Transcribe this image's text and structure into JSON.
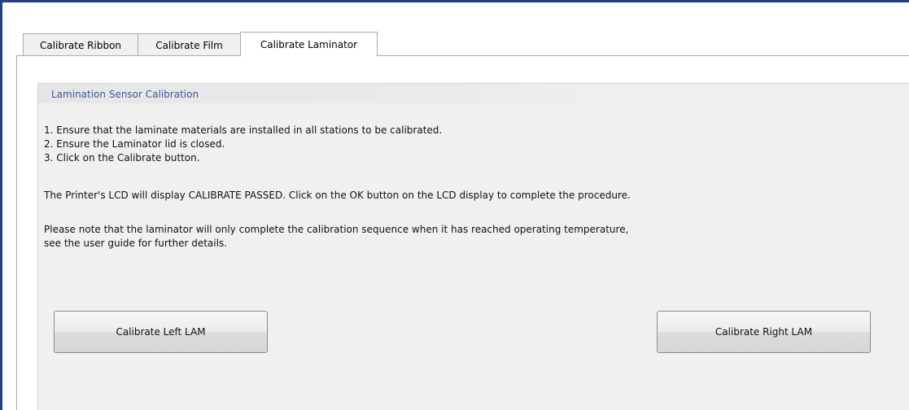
{
  "tabs": [
    {
      "label": "Calibrate Ribbon",
      "active": false
    },
    {
      "label": "Calibrate Film",
      "active": false
    },
    {
      "label": "Calibrate Laminator",
      "active": true
    }
  ],
  "group": {
    "title": "Lamination Sensor Calibration",
    "steps": [
      "1. Ensure that the laminate materials are installed in all stations to be calibrated.",
      "2. Ensure the Laminator lid is closed.",
      "3. Click on the Calibrate button."
    ],
    "lcd_note": "The Printer's LCD will display CALIBRATE PASSED.  Click on the OK button on the LCD display to complete the procedure.",
    "temp_note": [
      "Please note that the laminator will only complete the calibration sequence when it has reached operating temperature,",
      "see the user guide for further details."
    ]
  },
  "buttons": {
    "left_label": "Calibrate Left LAM",
    "right_label": "Calibrate Right LAM"
  },
  "colors": {
    "frame": "#1f3f93",
    "group_title": "#3a5a9b",
    "panel_bg": "#f0f0f0"
  }
}
